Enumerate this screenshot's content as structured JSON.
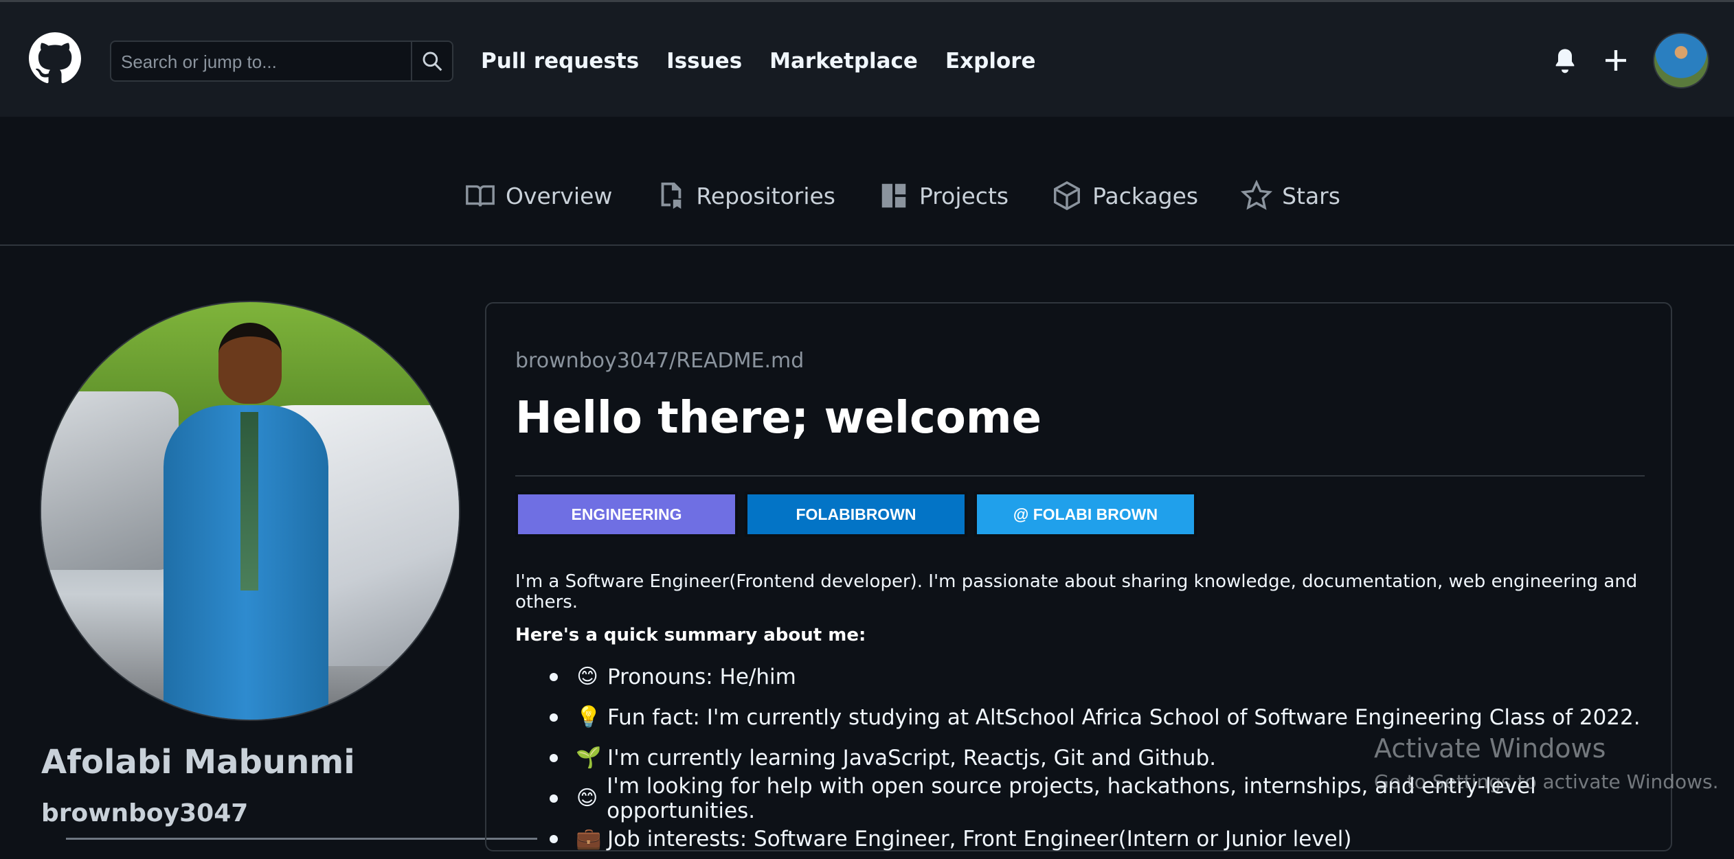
{
  "header": {
    "search_placeholder": "Search or jump to...",
    "nav": [
      "Pull requests",
      "Issues",
      "Marketplace",
      "Explore"
    ]
  },
  "profile_tabs": [
    {
      "label": "Overview",
      "icon": "book-icon"
    },
    {
      "label": "Repositories",
      "icon": "repo-icon"
    },
    {
      "label": "Projects",
      "icon": "project-icon"
    },
    {
      "label": "Packages",
      "icon": "package-icon"
    },
    {
      "label": "Stars",
      "icon": "star-icon"
    }
  ],
  "profile": {
    "name": "Afolabi Mabunmi",
    "login": "brownboy3047"
  },
  "readme": {
    "path": "brownboy3047/README.md",
    "title": "Hello there; welcome",
    "badges": [
      "ENGINEERING",
      "FOLABIBROWN",
      "@ FOLABI BROWN"
    ],
    "intro": "I'm a Software Engineer(Frontend developer). I'm passionate about sharing knowledge, documentation, web engineering and others.",
    "summary_heading": "Here's a quick summary about me:",
    "summary_items": [
      {
        "emoji": "😊",
        "text": "Pronouns: He/him"
      },
      {
        "emoji": "💡",
        "text": "Fun fact: I'm currently studying at AltSchool Africa School of Software Engineering Class of 2022."
      },
      {
        "emoji": "🌱",
        "text": "I'm currently learning JavaScript, Reactjs, Git and Github."
      },
      {
        "emoji": "😊",
        "text": "I'm looking for help with open source projects, hackathons, internships, and entry-level opportunities."
      },
      {
        "emoji": "💼",
        "text": "Job interests: Software Engineer, Front Engineer(Intern or Junior level)"
      }
    ]
  },
  "watermark": {
    "title": "Activate Windows",
    "subtitle": "Go to Settings to activate Windows."
  },
  "colors": {
    "background": "#0d1117",
    "header": "#161b22",
    "border": "#30363d",
    "badge_engineering": "#6f6fe3",
    "badge_folabibrown": "#0374c6",
    "badge_folabi_brown": "#20a0eb"
  }
}
